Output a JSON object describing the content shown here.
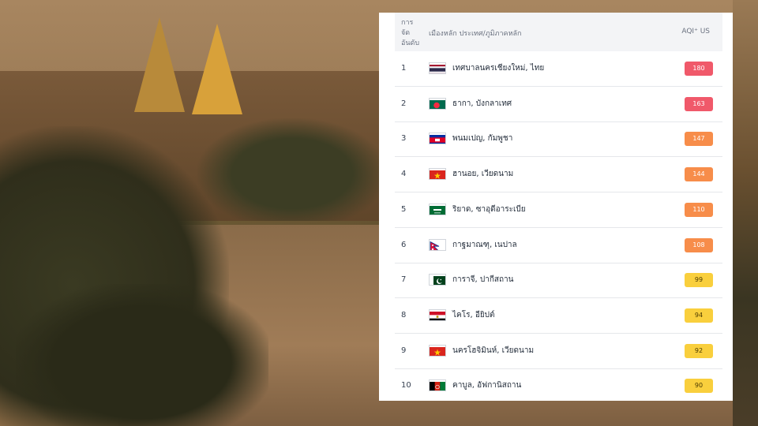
{
  "table": {
    "headers": {
      "rank": "การ จัด อันดับ",
      "city": "เมืองหลัก ประเทศ/ภูมิภาคหลัก",
      "aqi": "AQI⁺ US"
    },
    "rows": [
      {
        "rank": "1",
        "city": "เทศบาลนครเชียงใหม่, ไทย",
        "aqi": "180",
        "flag": "thailand-flag-icon",
        "level": "red"
      },
      {
        "rank": "2",
        "city": "ธากา, บังกลาเทศ",
        "aqi": "163",
        "flag": "bangladesh-flag-icon",
        "level": "red"
      },
      {
        "rank": "3",
        "city": "พนมเปญ, กัมพูชา",
        "aqi": "147",
        "flag": "cambodia-flag-icon",
        "level": "orange"
      },
      {
        "rank": "4",
        "city": "ฮานอย, เวียดนาม",
        "aqi": "144",
        "flag": "vietnam-flag-icon",
        "level": "orange"
      },
      {
        "rank": "5",
        "city": "ริยาด, ซาอุดีอาระเบีย",
        "aqi": "110",
        "flag": "saudi-arabia-flag-icon",
        "level": "orange"
      },
      {
        "rank": "6",
        "city": "กาฐมาณฑุ, เนปาล",
        "aqi": "108",
        "flag": "nepal-flag-icon",
        "level": "orange"
      },
      {
        "rank": "7",
        "city": "การาจี, ปากีสถาน",
        "aqi": "99",
        "flag": "pakistan-flag-icon",
        "level": "yellow"
      },
      {
        "rank": "8",
        "city": "ไคโร, อียิปต์",
        "aqi": "94",
        "flag": "egypt-flag-icon",
        "level": "yellow"
      },
      {
        "rank": "9",
        "city": "นครโฮจิมินห์, เวียดนาม",
        "aqi": "92",
        "flag": "vietnam-flag-icon",
        "level": "yellow"
      },
      {
        "rank": "10",
        "city": "คาบูล, อัฟกานิสถาน",
        "aqi": "90",
        "flag": "afghanistan-flag-icon",
        "level": "yellow"
      }
    ]
  },
  "colors": {
    "red": "#f0596a",
    "orange": "#f78d4a",
    "yellow": "#f9cf3d",
    "header_bg": "#f3f4f6"
  }
}
